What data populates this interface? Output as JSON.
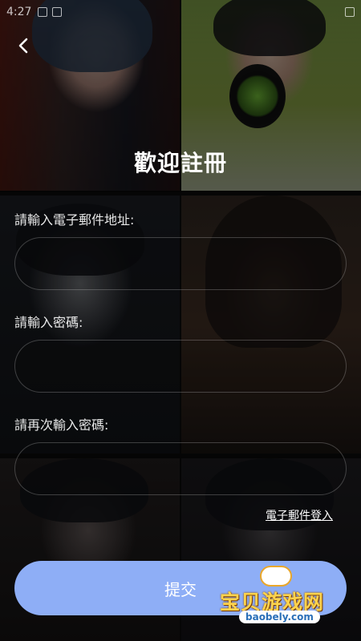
{
  "status_bar": {
    "time": "4:27"
  },
  "header": {
    "title": "歡迎註冊",
    "back_icon": "chevron-left-icon"
  },
  "form": {
    "email_label": "請輸入電子郵件地址:",
    "email_value": "",
    "password_label": "請輸入密碼:",
    "password_value": "",
    "confirm_label": "請再次輸入密碼:",
    "confirm_value": ""
  },
  "links": {
    "email_login": "電子郵件登入"
  },
  "actions": {
    "submit_label": "提交"
  },
  "watermark": {
    "text": "宝贝游戏网",
    "url": "baobely.com"
  },
  "colors": {
    "submit_bg": "#8eaef6",
    "background": "#0b0b0c",
    "text": "#ffffff"
  }
}
